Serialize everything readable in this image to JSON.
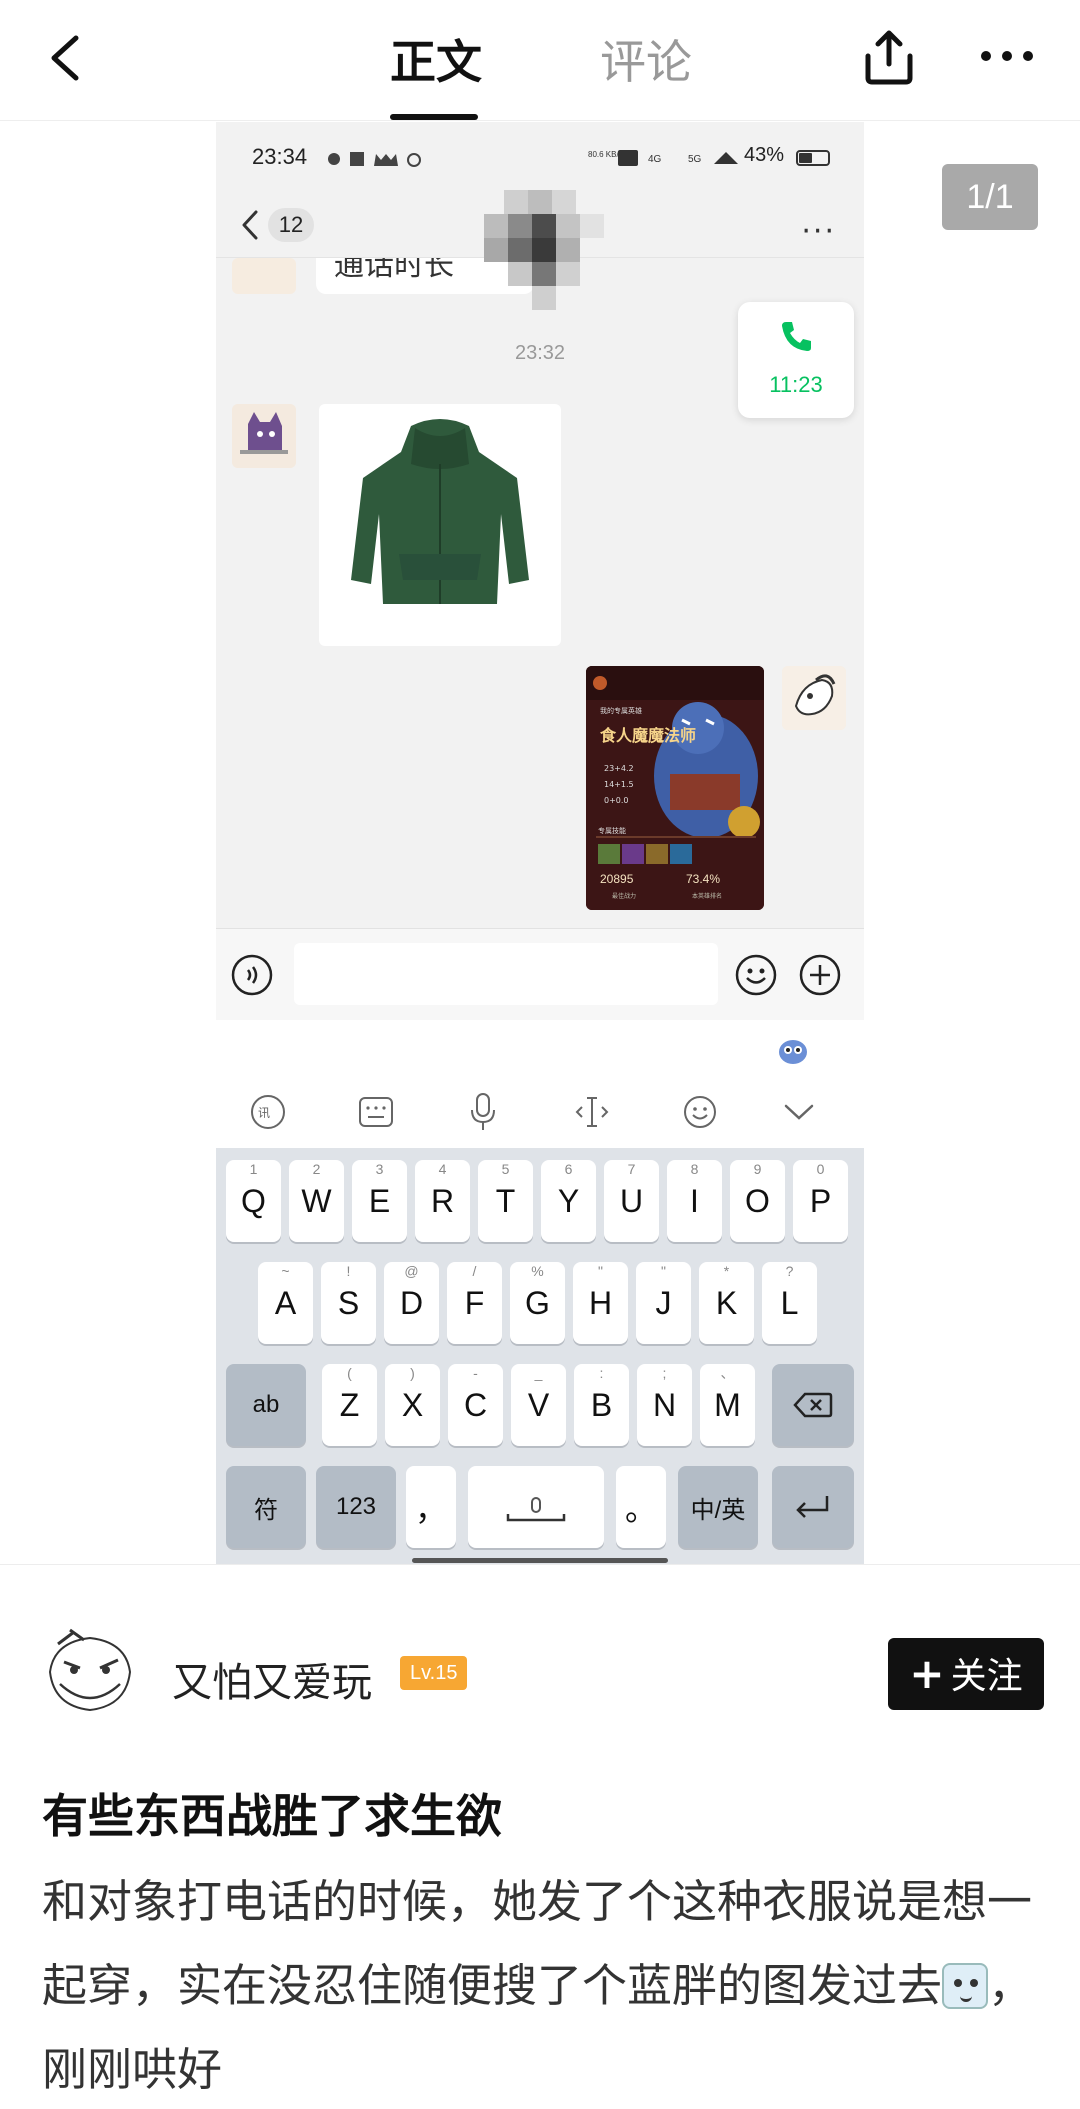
{
  "topbar": {
    "tab_main": "正文",
    "tab_comment": "评论"
  },
  "page_indicator": "1/1",
  "screenshot": {
    "status_time": "23:34",
    "status_speed": "80.6 KB/s",
    "status_battery": "43%",
    "unread_count": "12",
    "partial_message": "通话时长",
    "call_duration": "11:23",
    "time_separator": "23:32",
    "game_card": {
      "subtitle": "我的专属英雄",
      "hero": "食人魔魔法师",
      "stats": [
        "23+4.2",
        "14+1.5",
        "0+0.0"
      ],
      "section": "专属技能",
      "power": "20895",
      "power_label": "最佳战力",
      "rank": "73.4%",
      "rank_label": "本英雄排名"
    },
    "keyboard": {
      "row1": [
        {
          "main": "Q",
          "sub": "1"
        },
        {
          "main": "W",
          "sub": "2"
        },
        {
          "main": "E",
          "sub": "3"
        },
        {
          "main": "R",
          "sub": "4"
        },
        {
          "main": "T",
          "sub": "5"
        },
        {
          "main": "Y",
          "sub": "6"
        },
        {
          "main": "U",
          "sub": "7"
        },
        {
          "main": "I",
          "sub": "8"
        },
        {
          "main": "O",
          "sub": "9"
        },
        {
          "main": "P",
          "sub": "0"
        }
      ],
      "row2": [
        {
          "main": "A",
          "sub": "~"
        },
        {
          "main": "S",
          "sub": "!"
        },
        {
          "main": "D",
          "sub": "@"
        },
        {
          "main": "F",
          "sub": "/"
        },
        {
          "main": "G",
          "sub": "%"
        },
        {
          "main": "H",
          "sub": "\""
        },
        {
          "main": "J",
          "sub": "\""
        },
        {
          "main": "K",
          "sub": "*"
        },
        {
          "main": "L",
          "sub": "?"
        }
      ],
      "row3": [
        {
          "main": "Z",
          "sub": "("
        },
        {
          "main": "X",
          "sub": ")"
        },
        {
          "main": "C",
          "sub": "-"
        },
        {
          "main": "V",
          "sub": "_"
        },
        {
          "main": "B",
          "sub": ":"
        },
        {
          "main": "N",
          "sub": ";"
        },
        {
          "main": "M",
          "sub": "、"
        }
      ],
      "shift_label": "ab",
      "symbol_label": "符",
      "num_label": "123",
      "comma_label": "，",
      "period_label": "。",
      "lang_label": "中/英"
    }
  },
  "author": {
    "name": "又怕又爱玩",
    "level": "Lv.15",
    "follow_label": "关注"
  },
  "post": {
    "title": "有些东西战胜了求生欲",
    "body_1": "和对象打电话的时候，她发了个这种衣服说是想一起穿，实在没忍住随便搜了个蓝胖的图发过去",
    "body_2": "，刚刚哄好"
  },
  "colors": {
    "level_badge": "#f7a733",
    "call_green": "#07c160",
    "follow_bg": "#111111"
  }
}
